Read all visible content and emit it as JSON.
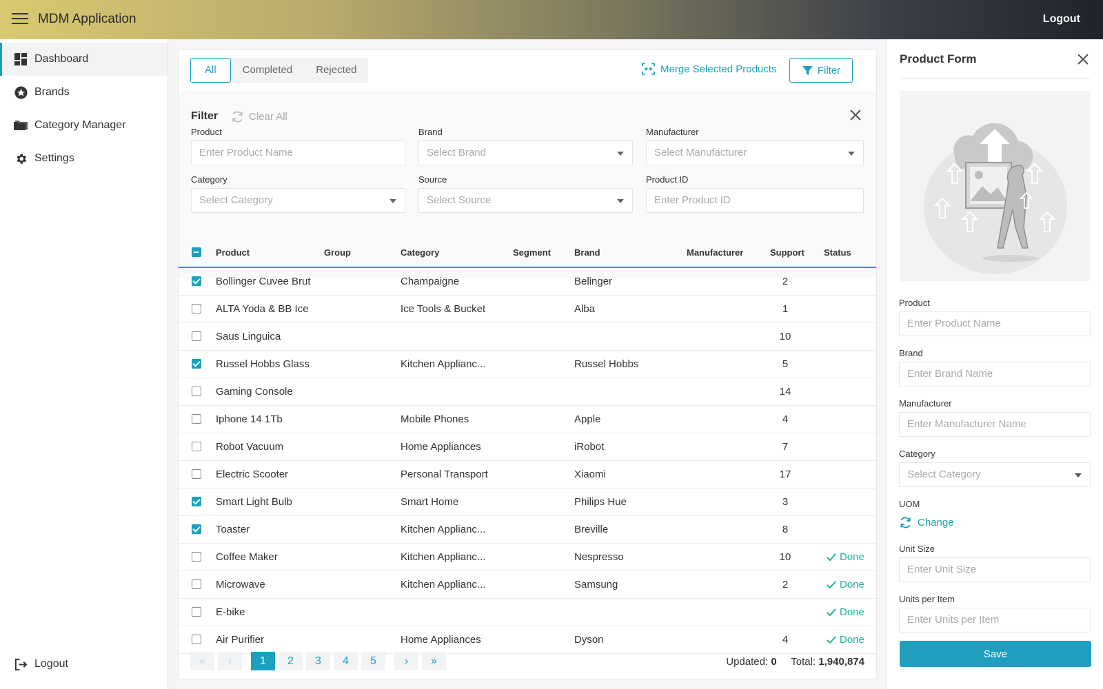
{
  "header": {
    "app_title": "MDM Application",
    "logout_label": "Logout"
  },
  "sidebar": {
    "items": [
      {
        "label": "Dashboard",
        "icon": "dashboard-icon"
      },
      {
        "label": "Brands",
        "icon": "star-badge-icon"
      },
      {
        "label": "Category Manager",
        "icon": "folder-icon"
      },
      {
        "label": "Settings",
        "icon": "gear-icon"
      }
    ],
    "logout_label": "Logout"
  },
  "toolbar": {
    "tabs": [
      "All",
      "Completed",
      "Rejected"
    ],
    "merge_label": "Merge Selected Products",
    "filter_label": "Filter"
  },
  "filter": {
    "title": "Filter",
    "clear_all": "Clear All",
    "product_label": "Product",
    "product_placeholder": "Enter Product Name",
    "brand_label": "Brand",
    "brand_placeholder": "Select Brand",
    "manufacturer_label": "Manufacturer",
    "manufacturer_placeholder": "Select Manufacturer",
    "category_label": "Category",
    "category_placeholder": "Select Category",
    "source_label": "Source",
    "source_placeholder": "Select Source",
    "productid_label": "Product ID",
    "productid_placeholder": "Enter Product ID"
  },
  "table": {
    "columns": [
      "Product",
      "Group",
      "Category",
      "Segment",
      "Brand",
      "Manufacturer",
      "Support",
      "Status"
    ],
    "rows": [
      {
        "checked": true,
        "product": "Bollinger Cuvee Brut",
        "category": "Champaigne",
        "brand": "Belinger",
        "support": "2",
        "status": ""
      },
      {
        "checked": false,
        "product": "ALTA Yoda & BB Ice",
        "category": "Ice Tools & Bucket",
        "brand": "Alba",
        "support": "1",
        "status": ""
      },
      {
        "checked": false,
        "product": "Saus Linguica",
        "category": "",
        "brand": "",
        "support": "10",
        "status": ""
      },
      {
        "checked": true,
        "product": "Russel Hobbs Glass",
        "category": "Kitchen Applianc...",
        "brand": "Russel Hobbs",
        "support": "5",
        "status": ""
      },
      {
        "checked": false,
        "product": "Gaming Console",
        "category": "",
        "brand": "",
        "support": "14",
        "status": ""
      },
      {
        "checked": false,
        "product": "Iphone 14 1Tb",
        "category": "Mobile Phones",
        "brand": "Apple",
        "support": "4",
        "status": ""
      },
      {
        "checked": false,
        "product": "Robot Vacuum",
        "category": "Home Appliances",
        "brand": "iRobot",
        "support": "7",
        "status": ""
      },
      {
        "checked": false,
        "product": "Electric Scooter",
        "category": "Personal Transport",
        "brand": "Xiaomi",
        "support": "17",
        "status": ""
      },
      {
        "checked": true,
        "product": "Smart Light Bulb",
        "category": "Smart Home",
        "brand": "Philips Hue",
        "support": "3",
        "status": ""
      },
      {
        "checked": true,
        "product": "Toaster",
        "category": "Kitchen Applianc...",
        "brand": "Breville",
        "support": "8",
        "status": ""
      },
      {
        "checked": false,
        "product": "Coffee  Maker",
        "category": "Kitchen Applianc...",
        "brand": "Nespresso",
        "support": "10",
        "status": "Done"
      },
      {
        "checked": false,
        "product": "Microwave",
        "category": "Kitchen Applianc...",
        "brand": "Samsung",
        "support": "2",
        "status": "Done"
      },
      {
        "checked": false,
        "product": "E-bike",
        "category": "",
        "brand": "",
        "support": "",
        "status": "Done"
      },
      {
        "checked": false,
        "product": "Air Purifier",
        "category": "Home Appliances",
        "brand": "Dyson",
        "support": "4",
        "status": "Done"
      }
    ]
  },
  "pagination": {
    "first": "«",
    "prev": "‹",
    "next": "›",
    "last": "»",
    "pages": [
      "1",
      "2",
      "3",
      "4",
      "5"
    ],
    "current": "1",
    "updated_label": "Updated:",
    "updated_value": "0",
    "total_label": "Total:",
    "total_value": "1,940,874"
  },
  "form": {
    "title": "Product Form",
    "product_label": "Product",
    "product_placeholder": "Enter Product Name",
    "brand_label": "Brand",
    "brand_placeholder": "Enter Brand Name",
    "manufacturer_label": "Manufacturer",
    "manufacturer_placeholder": "Enter Manufacturer Name",
    "category_label": "Category",
    "category_placeholder": "Select Category",
    "uom_label": "UOM",
    "change_label": "Change",
    "unitsize_label": "Unit Size",
    "unitsize_placeholder": "Enter Unit Size",
    "unitsper_label": "Units per Item",
    "unitsper_placeholder": "Enter Units per Item",
    "save_label": "Save"
  },
  "colors": {
    "accent": "#1aa0c0",
    "done": "#1ab394",
    "header_start": "#d9c970",
    "header_end": "#1f232b"
  }
}
